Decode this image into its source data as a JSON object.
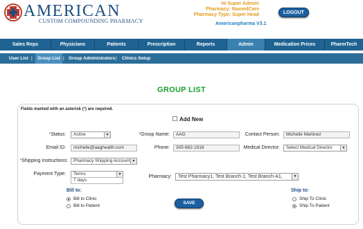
{
  "header": {
    "brand": "AMERICAN",
    "brand_sub": "CUSTOM COMPOUNDING PHARMACY",
    "welcome": "Hi Super Admin!",
    "pharmacy": "Pharmacy: NumedCare",
    "pharmacy_type": "Pharmacy Type: Super Head",
    "version": "Americanpharma V3.1",
    "logout": "LOGOUT"
  },
  "nav": [
    "Sales Reps",
    "Physicians",
    "Patients",
    "Prescription",
    "Reports",
    "Admin",
    "Medication Prices",
    "PharmTech"
  ],
  "nav_active": "Admin",
  "subnav": [
    "User List",
    "Group List",
    "Group Administrators",
    "Clinics Setup"
  ],
  "subnav_sep": "|",
  "subnav_active": "Group List",
  "page": {
    "title": "GROUP LIST"
  },
  "form": {
    "required_note_pre": "Fields marked with an asterisk (",
    "star": "*",
    "required_note_post": ") are required.",
    "add_new": "Add New",
    "status": {
      "label": "Status:",
      "value": "Active"
    },
    "group_name": {
      "label": "Group Name:",
      "value": "AAG"
    },
    "contact_person": {
      "label": "Contact Person:",
      "value": "Michelle Martinez"
    },
    "email": {
      "label": "Email ID:",
      "value": "michelle@aaghealth.com"
    },
    "phone": {
      "label": "Phone:",
      "value": "305-682-1818"
    },
    "medical_director": {
      "label": "Medical Director:",
      "value": "Select Medical Director"
    },
    "shipping": {
      "label": "Shipping Instructions:",
      "value": "Pharmacy Shipping Account"
    },
    "payment_type": {
      "label": "Payment Type:",
      "value": "Terms",
      "days": "7 days"
    },
    "pharmacy": {
      "label": "Pharmacy:",
      "value": "Test Pharmacy1, Test Branch-1, Test Branch-A1,"
    },
    "bill_to": {
      "label": "Bill to:",
      "options": [
        "Bill to Clinic",
        "Bill to Patient"
      ],
      "selected": "Bill to Clinic"
    },
    "ship_to": {
      "label": "Ship to:",
      "options": [
        "Ship To Clinic",
        "Ship To Patient"
      ],
      "selected": "Ship To Patient"
    },
    "save": "SAVE"
  }
}
